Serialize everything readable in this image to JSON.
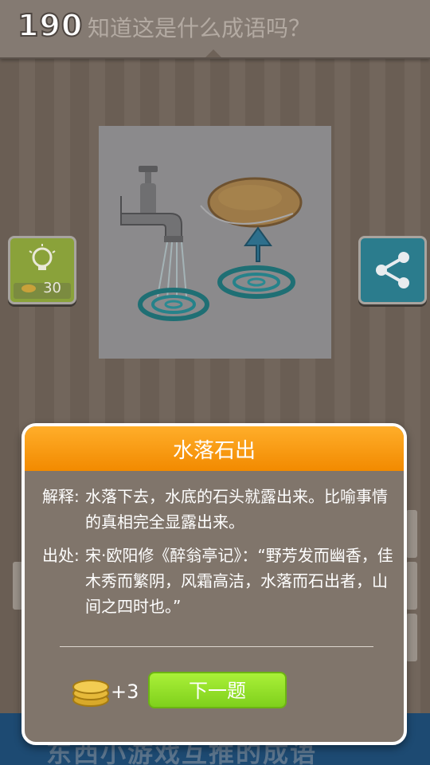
{
  "header": {
    "level": "190",
    "question": "知道这是什么成语吗？"
  },
  "hint": {
    "icon": "lightbulb-icon",
    "cost": "30",
    "color": "#8aa23a"
  },
  "share": {
    "icon": "share-icon",
    "color": "#2b7c8d"
  },
  "bottom_banner": {
    "text": "东西小游戏互推的成语"
  },
  "modal": {
    "title": "水落石出",
    "explanation_label": "解释:",
    "explanation": "水落下去，水底的石头就露出来。比喻事情的真相完全显露出来。",
    "source_label": "出处:",
    "source": "宋·欧阳修《醉翁亭记》：“野芳发而幽香，佳木秀而繁阴，风霜高洁，水落而石出者，山间之四时也。”",
    "reward": "+3",
    "next_button": "下一题",
    "title_color": "#f59a10",
    "button_color": "#8ee02a"
  }
}
